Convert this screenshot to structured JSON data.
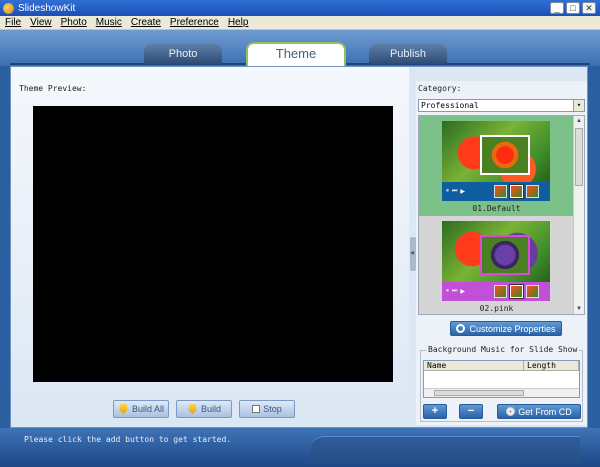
{
  "window": {
    "title": "SlideshowKit",
    "minimize": "_",
    "maximize": "□",
    "close": "✕"
  },
  "menu": [
    "File",
    "View",
    "Photo",
    "Music",
    "Create",
    "Preference",
    "Help"
  ],
  "tabs": [
    {
      "label": "Photo"
    },
    {
      "label": "Theme"
    },
    {
      "label": "Publish"
    }
  ],
  "preview": {
    "label": "Theme Preview:"
  },
  "buttons": {
    "build_all": "Build All",
    "build": "Build",
    "stop": "Stop"
  },
  "category": {
    "label": "Category:",
    "selected": "Professional",
    "arrow": "▾"
  },
  "themes": [
    {
      "name": "01.Default",
      "selected": true
    },
    {
      "name": "02.pink",
      "selected": false
    }
  ],
  "thumb_controls": [
    "⏸",
    "⏭",
    "▶"
  ],
  "customize": {
    "label": "Customize Properties"
  },
  "music": {
    "title": "Background Music for Slide Show",
    "columns": [
      "Name",
      "Length"
    ],
    "add": "+",
    "remove": "−",
    "get_from_cd": "Get From CD"
  },
  "status": {
    "message": "Please click the add button to get started."
  },
  "colors": {
    "accent": "#2a63a8",
    "selected_theme": "#7cc08a",
    "tab_active_border": "#8fc25d"
  }
}
